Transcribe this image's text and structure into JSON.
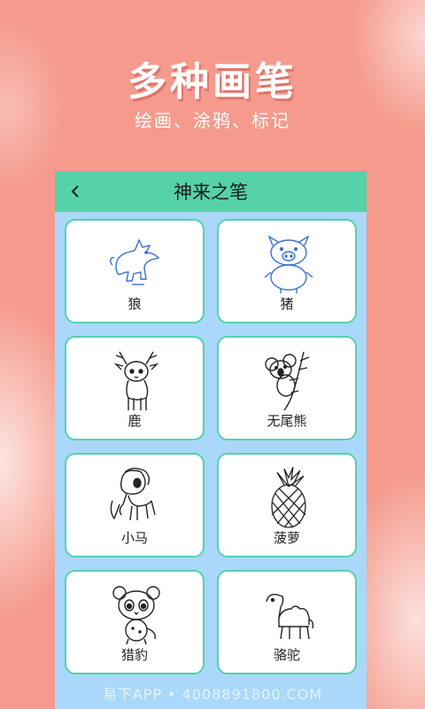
{
  "promo": {
    "headline": "多种画笔",
    "subline": "绘画、涂鸦、标记"
  },
  "screen": {
    "title": "神来之笔",
    "back_icon": "chevron-left-icon",
    "colors": {
      "header": "#55d2aa",
      "background": "#a9d8fb",
      "card_border": "#55d2aa"
    },
    "items": [
      {
        "label": "狼",
        "icon": "wolf-drawing"
      },
      {
        "label": "猪",
        "icon": "pig-drawing"
      },
      {
        "label": "鹿",
        "icon": "deer-drawing"
      },
      {
        "label": "无尾熊",
        "icon": "koala-drawing"
      },
      {
        "label": "小马",
        "icon": "pony-drawing"
      },
      {
        "label": "菠萝",
        "icon": "pineapple-drawing"
      },
      {
        "label": "猎豹",
        "icon": "cheetah-drawing"
      },
      {
        "label": "骆驼",
        "icon": "camel-drawing"
      }
    ]
  },
  "watermark": "易下APP • 4008891800.COM"
}
